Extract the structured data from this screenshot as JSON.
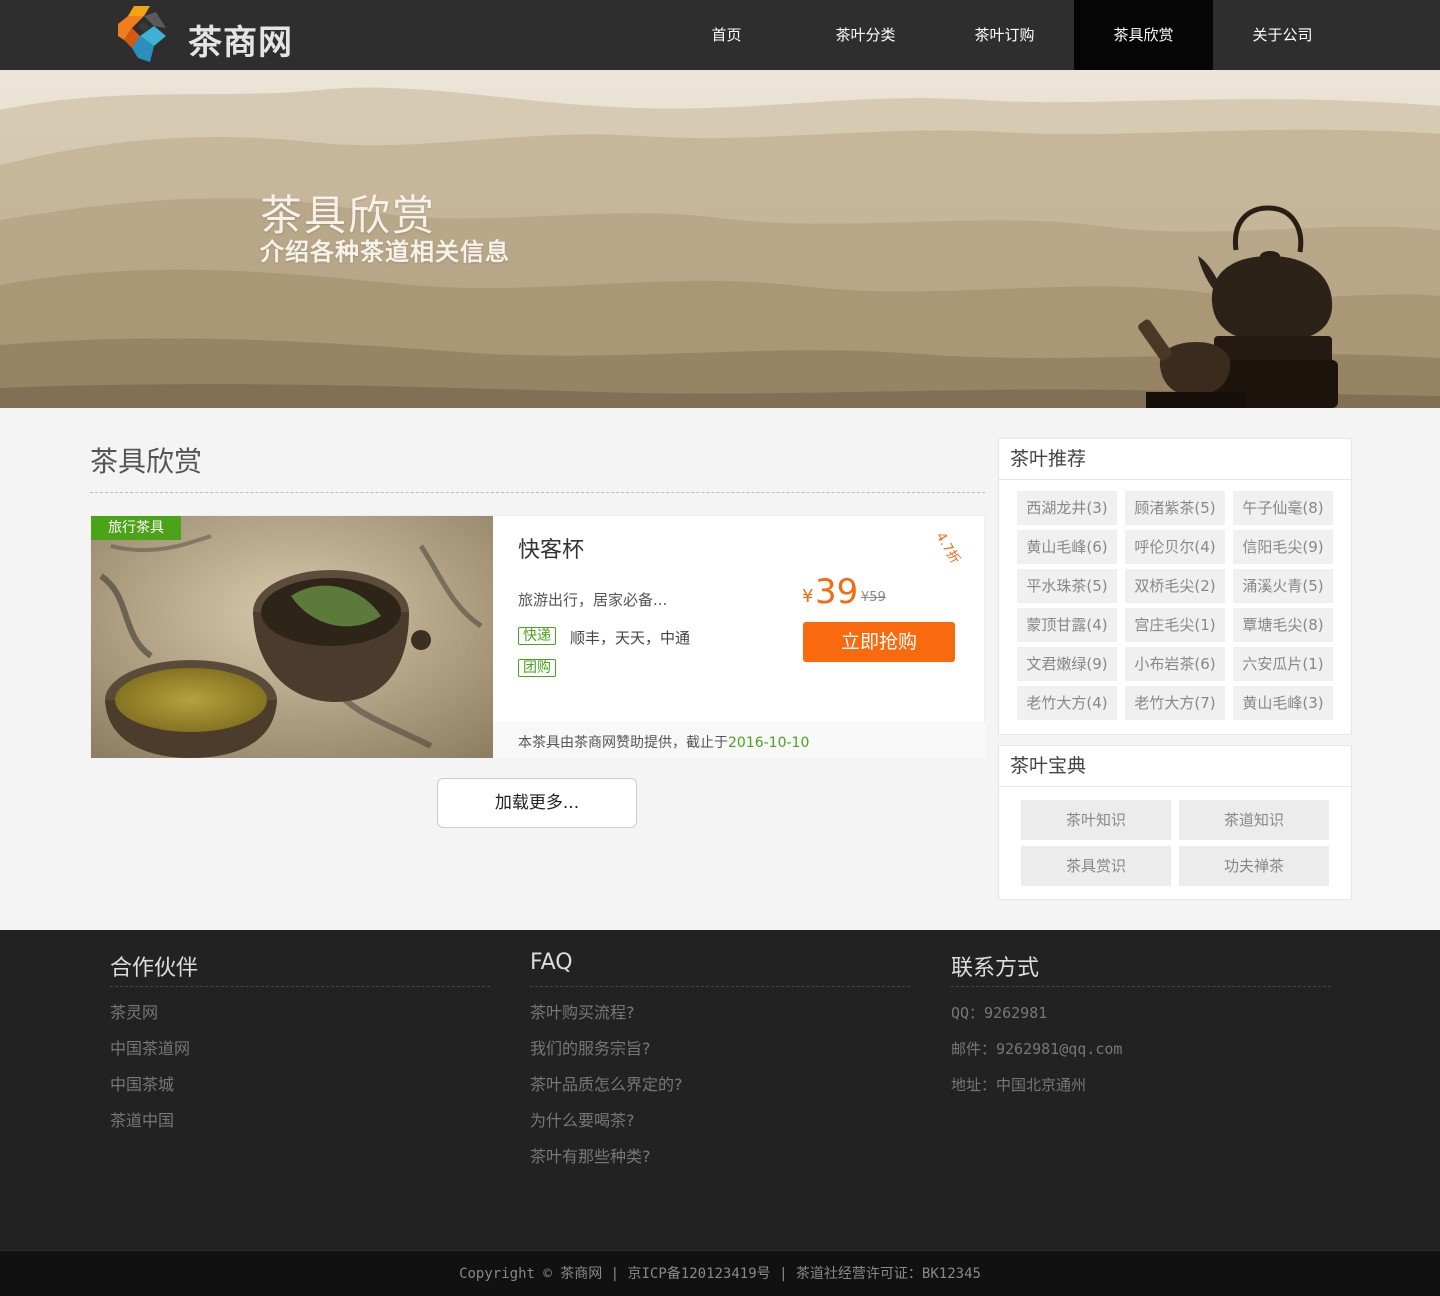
{
  "header": {
    "logo_text": "茶商网",
    "nav": [
      {
        "label": "首页",
        "active": false
      },
      {
        "label": "茶叶分类",
        "active": false
      },
      {
        "label": "茶叶订购",
        "active": false
      },
      {
        "label": "茶具欣赏",
        "active": true
      },
      {
        "label": "关于公司",
        "active": false
      }
    ]
  },
  "banner": {
    "title": "茶具欣赏",
    "subtitle": "介绍各种茶道相关信息"
  },
  "main": {
    "title": "茶具欣赏",
    "product": {
      "tag": "旅行茶具",
      "name": "快客杯",
      "description": "旅游出行，居家必备...",
      "express_badge": "快递",
      "express_text": "顺丰，天天，中通",
      "group_badge": "团购",
      "currency": "¥",
      "price": "39",
      "original_price": "¥59",
      "discount": "4.7折",
      "buy_label": "立即抢购",
      "footer_text": "本茶具由茶商网赞助提供，截止于",
      "footer_date": "2016-10-10"
    },
    "load_more": "加载更多..."
  },
  "sidebar": {
    "recommend": {
      "title": "茶叶推荐",
      "tags": [
        "西湖龙井(3)",
        "顾渚紫茶(5)",
        "午子仙毫(8)",
        "黄山毛峰(6)",
        "呼伦贝尔(4)",
        "信阳毛尖(9)",
        "平水珠茶(5)",
        "双桥毛尖(2)",
        "涌溪火青(5)",
        "蒙顶甘露(4)",
        "宫庄毛尖(1)",
        "覃塘毛尖(8)",
        "文君嫩绿(9)",
        "小布岩茶(6)",
        "六安瓜片(1)",
        "老竹大方(4)",
        "老竹大方(7)",
        "黄山毛峰(3)"
      ]
    },
    "dictionary": {
      "title": "茶叶宝典",
      "items": [
        "茶叶知识",
        "茶道知识",
        "茶具赏识",
        "功夫禅茶"
      ]
    }
  },
  "footer": {
    "partners": {
      "title": "合作伙伴",
      "links": [
        "茶灵网",
        "中国茶道网",
        "中国茶城",
        "茶道中国"
      ]
    },
    "faq": {
      "title": "FAQ",
      "links": [
        "茶叶购买流程?",
        "我们的服务宗旨?",
        "茶叶品质怎么界定的?",
        "为什么要喝茶?",
        "茶叶有那些种类?"
      ]
    },
    "contact": {
      "title": "联系方式",
      "items": [
        "QQ：9262981",
        "邮件：9262981@qq.com",
        "地址：中国北京通州"
      ]
    },
    "copyright": "Copyright © 茶商网 | 京ICP备120123419号 | 茶道社经营许可证：BK12345"
  },
  "colors": {
    "header_bg": "#2e2e2e",
    "nav_active_bg": "#050505",
    "accent_orange": "#f96a0e",
    "accent_green": "#4aa319",
    "footer_bg": "#222222"
  }
}
